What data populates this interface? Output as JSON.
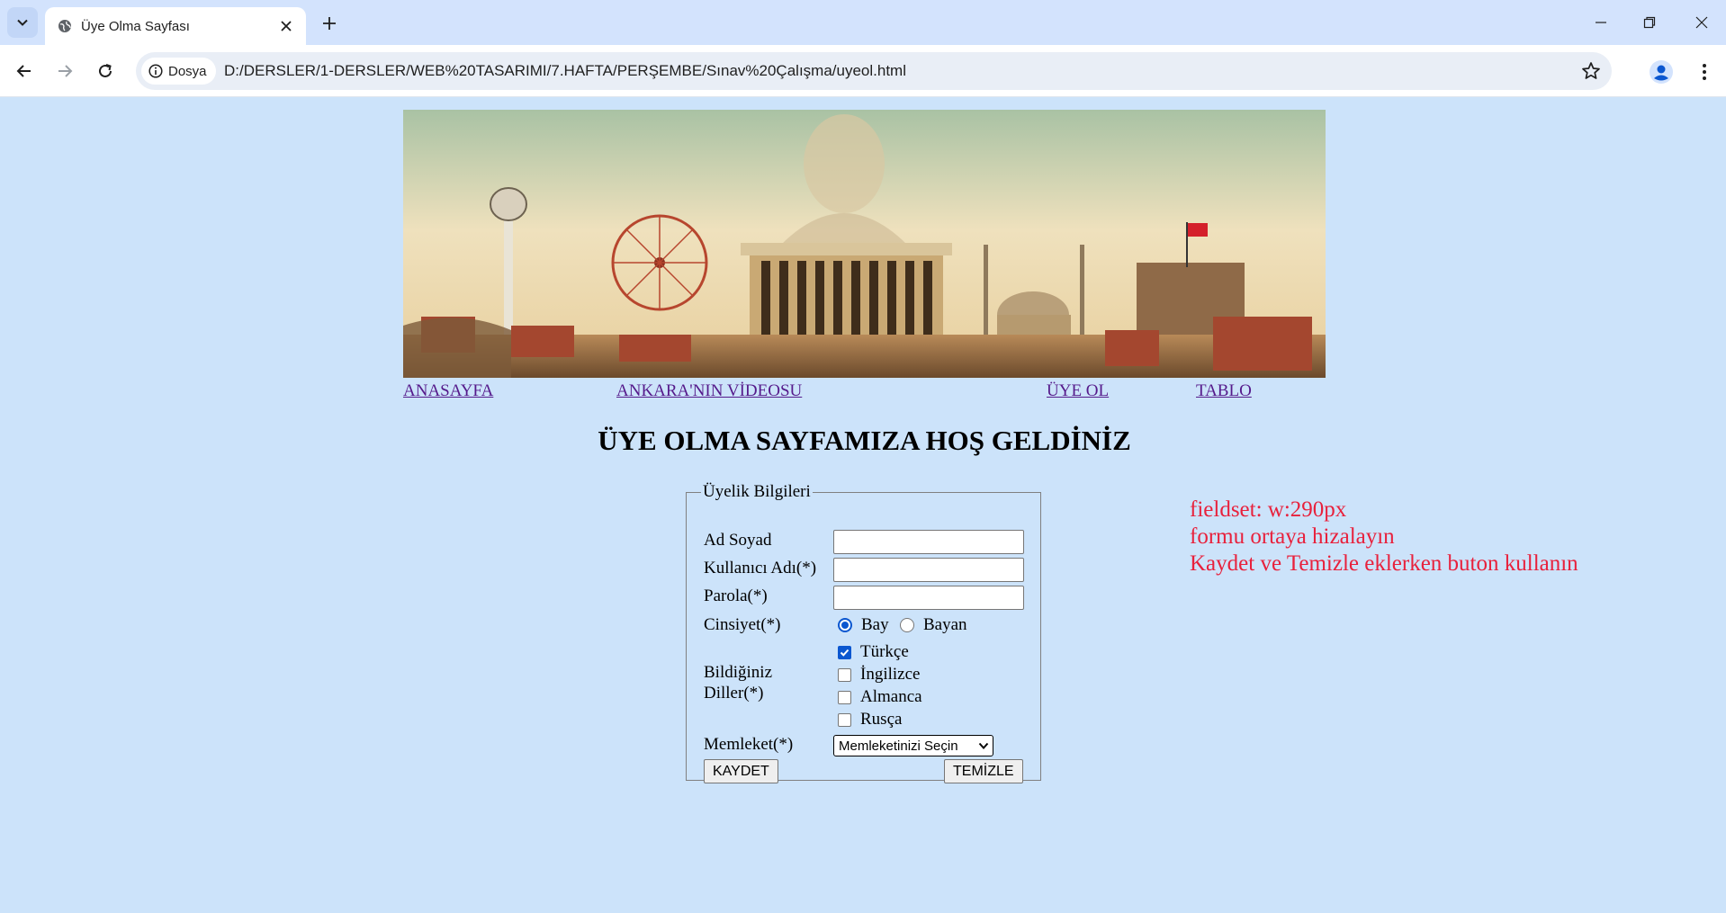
{
  "browser": {
    "tab_title": "Üye Olma Sayfası",
    "site_chip_label": "Dosya",
    "url": "D:/DERSLER/1-DERSLER/WEB%20TASARIMI/7.HAFTA/PERŞEMBE/Sınav%20Çalışma/uyeol.html"
  },
  "nav": {
    "home": "ANASAYFA",
    "video": "ANKARA'NIN VİDEOSU",
    "signup": "ÜYE OL",
    "table": "TABLO"
  },
  "page": {
    "heading": "ÜYE OLMA SAYFAMIZA HOŞ GELDİNİZ"
  },
  "form": {
    "legend": "Üyelik Bilgileri",
    "name_label": "Ad Soyad",
    "name_value": "",
    "username_label": "Kullanıcı Adı(*)",
    "username_value": "",
    "password_label": "Parola(*)",
    "password_value": "",
    "gender_label": "Cinsiyet(*)",
    "gender_options": [
      {
        "label": "Bay",
        "selected": true
      },
      {
        "label": "Bayan",
        "selected": false
      }
    ],
    "languages_label_line1": "Bildiğiniz",
    "languages_label_line2": "Diller(*)",
    "languages": [
      {
        "label": "Türkçe",
        "checked": true
      },
      {
        "label": "İngilizce",
        "checked": false
      },
      {
        "label": "Almanca",
        "checked": false
      },
      {
        "label": "Rusça",
        "checked": false
      }
    ],
    "hometown_label": "Memleket(*)",
    "hometown_selected": "Memleketinizi Seçin",
    "save_button": "KAYDET",
    "clear_button": "TEMİZLE"
  },
  "note": {
    "line1": "fieldset: w:290px",
    "line2": "formu ortaya hizalayın",
    "line3": "Kaydet ve Temizle eklerken buton kullanın"
  },
  "colors": {
    "page_bg": "#cce3fa",
    "note_text": "#e8213c",
    "visited_link": "#551a8b",
    "accent": "#0b57d0"
  }
}
